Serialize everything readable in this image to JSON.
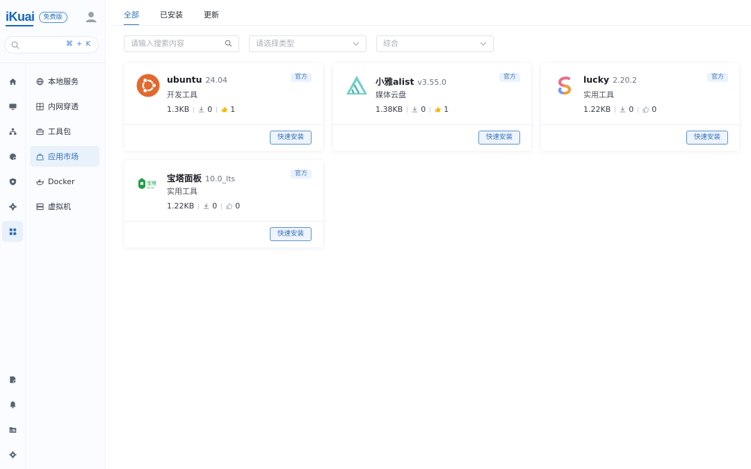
{
  "brand": {
    "logo_text": "iKuai",
    "edition_badge": "免费版",
    "brand_color": "#1565c0"
  },
  "search": {
    "shortcut": "⌘ + K"
  },
  "rail_icons": [
    "home-icon",
    "monitor-icon",
    "network-icon",
    "globe-icon",
    "shield-icon",
    "gear-flower-icon",
    "apps-grid-icon",
    "document-icon",
    "bell-icon",
    "log-icon",
    "settings-icon"
  ],
  "nav": {
    "items": [
      {
        "label": "本地服务",
        "icon": "globe-icon"
      },
      {
        "label": "内网穿透",
        "icon": "grid-icon"
      },
      {
        "label": "工具包",
        "icon": "toolbox-icon"
      },
      {
        "label": "应用市场",
        "icon": "appstore-icon",
        "active": true
      },
      {
        "label": "Docker",
        "icon": "docker-icon"
      },
      {
        "label": "虚拟机",
        "icon": "server-icon"
      }
    ]
  },
  "tabs": [
    {
      "label": "全部",
      "active": true
    },
    {
      "label": "已安装"
    },
    {
      "label": "更新"
    }
  ],
  "filters": {
    "search_placeholder": "请输入搜索内容",
    "type_placeholder": "请选择类型",
    "sort_value": "综合"
  },
  "apps": [
    {
      "name": "ubuntu",
      "version": "24.04",
      "category": "开发工具",
      "size": "1.3KB",
      "downloads": "0",
      "likes": "1",
      "liked": true,
      "official": "官方",
      "install_label": "快速安装",
      "icon": "ubuntu-icon"
    },
    {
      "name": "小雅alist",
      "version": "v3.55.0",
      "category": "媒体云盘",
      "size": "1.38KB",
      "downloads": "0",
      "likes": "1",
      "liked": true,
      "official": "官方",
      "install_label": "快速安装",
      "icon": "alist-icon"
    },
    {
      "name": "lucky",
      "version": "2.20.2",
      "category": "实用工具",
      "size": "1.22KB",
      "downloads": "0",
      "likes": "0",
      "liked": false,
      "official": "官方",
      "install_label": "快速安装",
      "icon": "lucky-icon"
    },
    {
      "name": "宝塔面板",
      "version": "10.0_lts",
      "category": "实用工具",
      "size": "1.22KB",
      "downloads": "0",
      "likes": "0",
      "liked": false,
      "official": "官方",
      "install_label": "快速安装",
      "icon": "bt-panel-icon",
      "icon_text": "宝塔",
      "icon_subtext": "BT.CN"
    }
  ],
  "colors": {
    "accent": "#2f6fb8",
    "like_active": "#f5b800"
  }
}
